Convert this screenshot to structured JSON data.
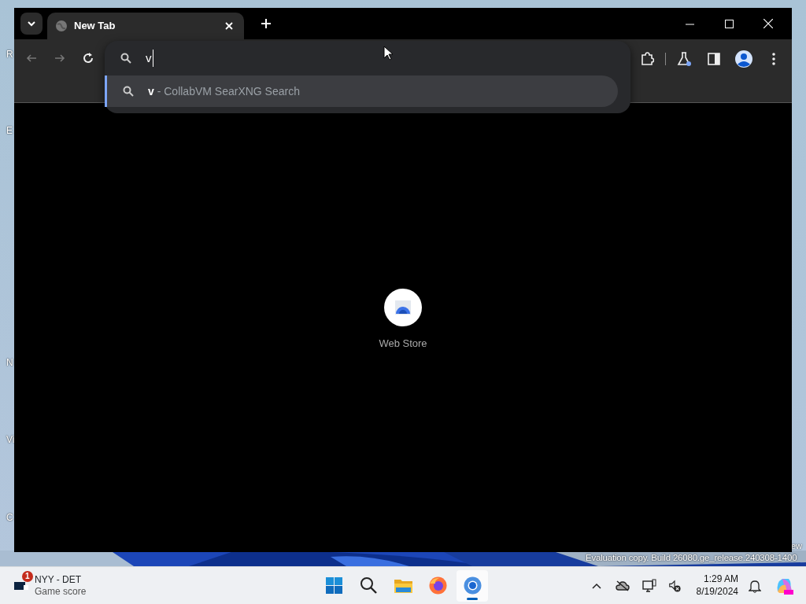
{
  "desktop": {
    "icon_labels": [
      "R",
      "E",
      "N",
      "Vi",
      "C"
    ],
    "corner_text": "ew",
    "build_text": "Evaluation copy. Build 26080.ge_release.240308-1400"
  },
  "browser": {
    "tabs": [
      {
        "title": "New Tab",
        "selected": true
      }
    ],
    "nav": {
      "back_disabled": true,
      "forward_disabled": true
    },
    "omnibox": {
      "value": "v"
    },
    "suggestions": [
      {
        "text": "**v** - CollabVM SearXNG Search",
        "selected": true
      }
    ],
    "shortcuts": [
      {
        "label": "Web Store"
      }
    ]
  },
  "taskbar": {
    "widget": {
      "badge": "1",
      "title": "NYY - DET",
      "subtitle": "Game score"
    },
    "apps": [
      {
        "kind": "start",
        "active": false
      },
      {
        "kind": "search",
        "active": false
      },
      {
        "kind": "explorer",
        "active": false
      },
      {
        "kind": "firefox",
        "active": false
      },
      {
        "kind": "chrome",
        "active": true
      }
    ],
    "clock": {
      "time": "1:29 AM",
      "date": "8/19/2024"
    }
  }
}
